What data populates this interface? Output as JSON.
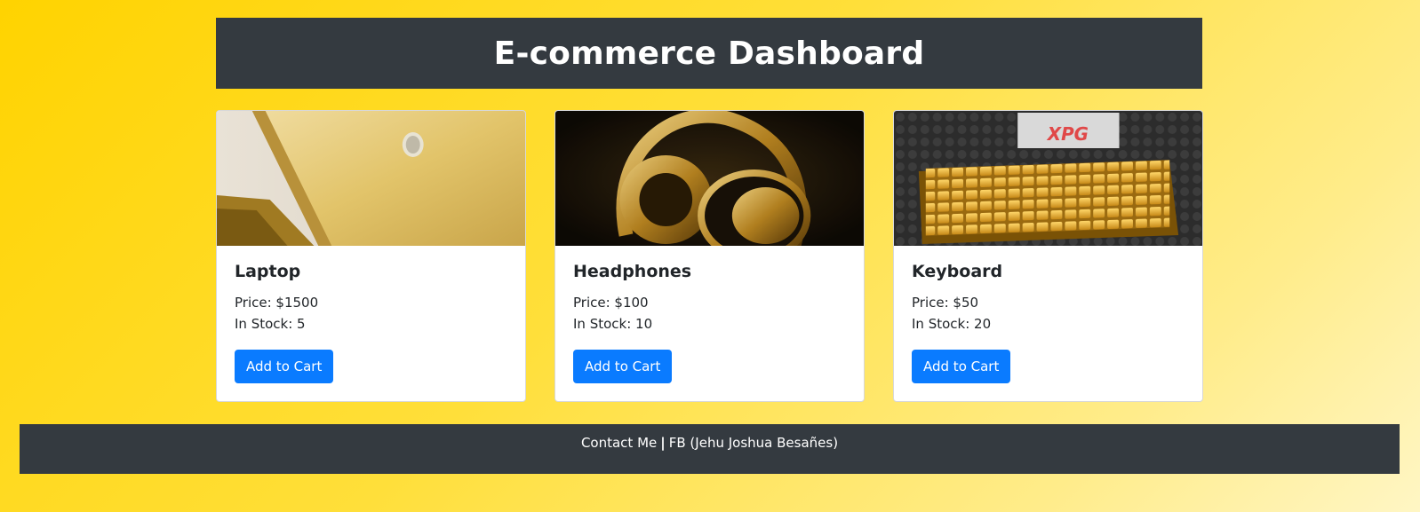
{
  "header": {
    "title": "E-commerce Dashboard"
  },
  "products": [
    {
      "name": "Laptop",
      "price": "Price: $1500",
      "stock": "In Stock: 5",
      "button": "Add to Cart",
      "image": "gold-laptop-image"
    },
    {
      "name": "Headphones",
      "price": "Price: $100",
      "stock": "In Stock: 10",
      "button": "Add to Cart",
      "image": "gold-headphones-image",
      "image_text": ""
    },
    {
      "name": "Keyboard",
      "price": "Price: $50",
      "stock": "In Stock: 20",
      "button": "Add to Cart",
      "image": "gold-keyboard-image",
      "image_text": "XPG"
    }
  ],
  "footer": {
    "contact": "Contact Me",
    "separator": "|",
    "fb": "FB (Jehu Joshua Besañes)"
  },
  "colors": {
    "header_bg": "#343a40",
    "button_bg": "#0a7bff",
    "page_bg_start": "#ffd300",
    "page_bg_end": "#fff6c4"
  }
}
